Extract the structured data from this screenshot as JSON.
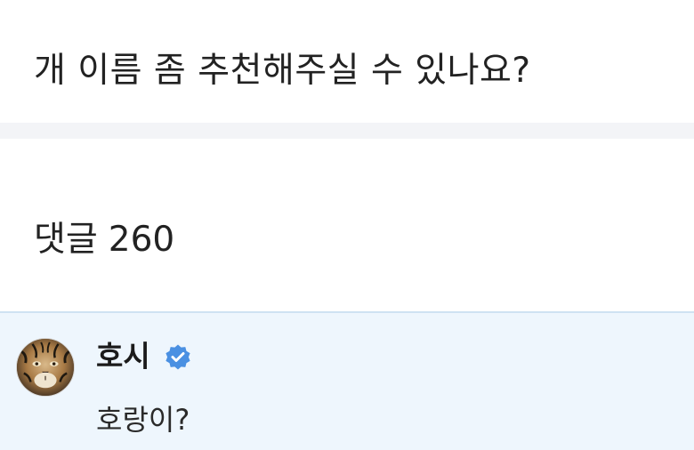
{
  "question": {
    "title": "개 이름 좀 추천해주실 수 있나요?"
  },
  "comments": {
    "label": "댓글",
    "count": "260"
  },
  "comment": {
    "author": "호시",
    "author_verified": true,
    "text": "호랑이?",
    "avatar_icon": "tiger-avatar",
    "verified_icon": "verified-badge-icon",
    "verified_color": "#4a90e2",
    "background_color": "#eef6fd"
  }
}
